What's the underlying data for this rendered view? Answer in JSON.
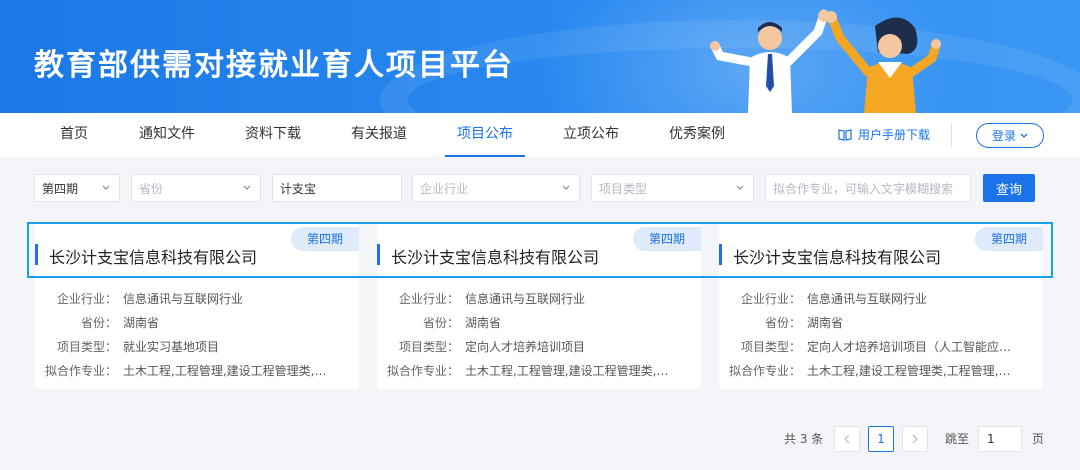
{
  "banner": {
    "title": "教育部供需对接就业育人项目平台"
  },
  "nav": {
    "items": [
      "首页",
      "通知文件",
      "资料下载",
      "有关报道",
      "项目公布",
      "立项公布",
      "优秀案例"
    ],
    "active": "项目公布",
    "manual": "用户手册下载",
    "login": "登录"
  },
  "filters": {
    "period": "第四期",
    "province_ph": "省份",
    "company": "计支宝",
    "industry_ph": "企业行业",
    "type_ph": "项目类型",
    "major_ph": "拟合作专业，可输入文字模糊搜索",
    "search": "查询"
  },
  "labels": {
    "industry": "企业行业：",
    "province": "省份：",
    "type": "项目类型：",
    "major": "拟合作专业："
  },
  "cards": [
    {
      "period": "第四期",
      "name": "长沙计支宝信息科技有限公司",
      "industry": "信息通讯与互联网行业",
      "province": "湖南省",
      "type": "就业实习基地项目",
      "major": "土木工程,工程管理,建设工程管理类,交…"
    },
    {
      "period": "第四期",
      "name": "长沙计支宝信息科技有限公司",
      "industry": "信息通讯与互联网行业",
      "province": "湖南省",
      "type": "定向人才培养培训项目",
      "major": "土木工程,工程管理,建设工程管理类,交…"
    },
    {
      "period": "第四期",
      "name": "长沙计支宝信息科技有限公司",
      "industry": "信息通讯与互联网行业",
      "province": "湖南省",
      "type": "定向人才培养培训项目（人工智能应用…",
      "major": "土木工程,建设工程管理类,工程管理,交…"
    }
  ],
  "pager": {
    "total": "共 3 条",
    "current": "1",
    "jump_label": "跳至",
    "jump_value": "1",
    "page_unit": "页"
  },
  "icons": {
    "manual": "book-icon",
    "login": "chevron-down-icon",
    "prev": "chevron-left-icon",
    "next": "chevron-right-icon"
  },
  "colors": {
    "accent": "#1a73e8",
    "banner": "#2a8af0",
    "tag_bg": "#dfeafb",
    "highlight": "#1aa0e8"
  }
}
